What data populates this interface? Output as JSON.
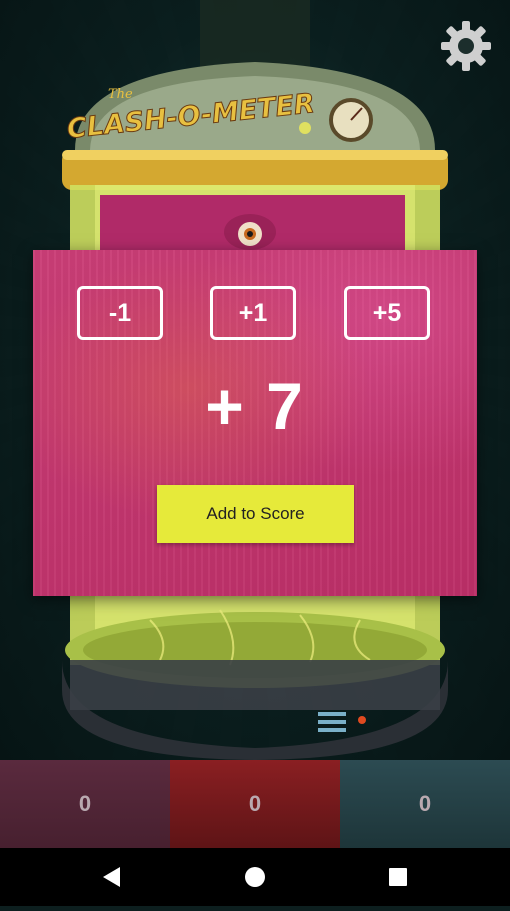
{
  "app": {
    "logo_text": "CLASH-O-METER",
    "logo_prefix": "The"
  },
  "icons": {
    "settings": "gear-icon",
    "back": "back-triangle-icon",
    "home": "home-circle-icon",
    "recents": "recents-square-icon"
  },
  "adjust_panel": {
    "buttons": [
      {
        "label": "-1"
      },
      {
        "label": "+1"
      },
      {
        "label": "+5"
      }
    ],
    "current_value": "+ 7",
    "add_label": "Add to Score"
  },
  "scores": [
    {
      "value": "0"
    },
    {
      "value": "0"
    },
    {
      "value": "0"
    }
  ],
  "colors": {
    "panel": "#c8326e",
    "add_button": "#e6ea3a",
    "player1": "#5a2a3e",
    "player2": "#8a1f22",
    "player3": "#2c4b52"
  }
}
